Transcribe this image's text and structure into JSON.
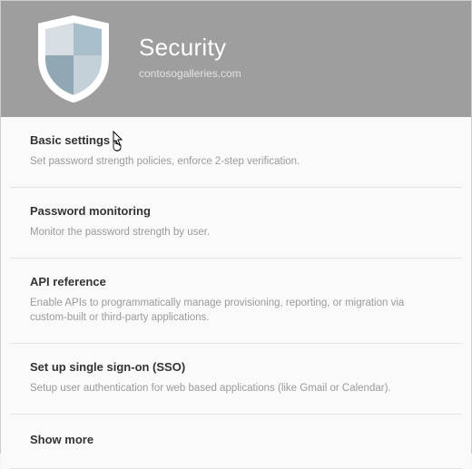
{
  "header": {
    "title": "Security",
    "subtitle": "contosogalleries.com"
  },
  "items": [
    {
      "title": "Basic settings",
      "desc": "Set password strength policies, enforce 2-step verification."
    },
    {
      "title": "Password monitoring",
      "desc": "Monitor the password strength by user."
    },
    {
      "title": "API reference",
      "desc": "Enable APIs to programmatically manage provisioning, reporting, or migration via custom-built or third-party applications."
    },
    {
      "title": "Set up single sign-on (SSO)",
      "desc": "Setup user authentication for web based applications (like Gmail or Calendar)."
    }
  ],
  "show_more_label": "Show more"
}
